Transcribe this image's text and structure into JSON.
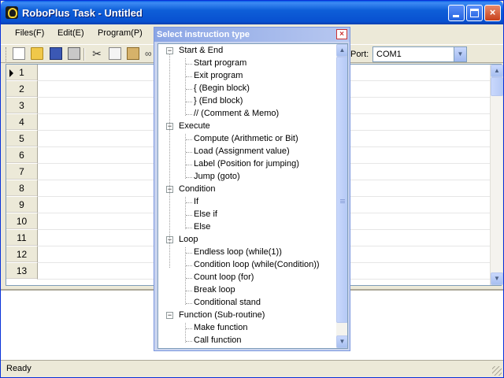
{
  "window": {
    "title": "RoboPlus Task - Untitled",
    "minimize_label": "",
    "maximize_label": "",
    "close_label": "×"
  },
  "menu": {
    "files": "Files(F)",
    "edit": "Edit(E)",
    "program": "Program(P)"
  },
  "toolbar": {
    "port_label": "Port:",
    "port_value": "COM1"
  },
  "grid": {
    "rows": [
      "1",
      "2",
      "3",
      "4",
      "5",
      "6",
      "7",
      "8",
      "9",
      "10",
      "11",
      "12",
      "13"
    ],
    "selected_row": "1"
  },
  "status": {
    "text": "Ready"
  },
  "dialog": {
    "title": "Select instruction type",
    "close_label": "×",
    "groups": [
      {
        "label": "Start & End",
        "items": [
          "Start program",
          "Exit program",
          "{ (Begin block)",
          "} (End block)",
          "// (Comment & Memo)"
        ]
      },
      {
        "label": "Execute",
        "items": [
          "Compute (Arithmetic or Bit)",
          "Load (Assignment value)",
          "Label (Position for jumping)",
          "Jump (goto)"
        ]
      },
      {
        "label": "Condition",
        "items": [
          "If",
          "Else if",
          "Else"
        ]
      },
      {
        "label": "Loop",
        "items": [
          "Endless loop (while(1))",
          "Condition loop (while(Condition))",
          "Count loop (for)",
          "Break loop",
          "Conditional stand"
        ]
      },
      {
        "label": "Function (Sub-routine)",
        "items": [
          "Make function",
          "Call function"
        ]
      }
    ]
  }
}
